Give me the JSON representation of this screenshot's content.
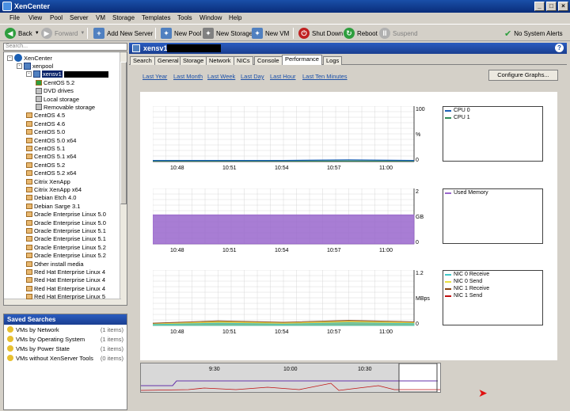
{
  "app": {
    "title": "XenCenter"
  },
  "menu": [
    "File",
    "View",
    "Pool",
    "Server",
    "VM",
    "Storage",
    "Templates",
    "Tools",
    "Window",
    "Help"
  ],
  "toolbar": {
    "back": "Back",
    "forward": "Forward",
    "add_server": "Add New Server",
    "new_pool": "New Pool",
    "new_storage": "New Storage",
    "new_vm": "New VM",
    "shutdown": "Shut Down",
    "reboot": "Reboot",
    "suspend": "Suspend",
    "alerts": "No System Alerts"
  },
  "search": {
    "placeholder": "Search..."
  },
  "tree": [
    {
      "label": "XenCenter",
      "type": "xc",
      "indent": 0,
      "exp": "-"
    },
    {
      "label": "xenpool",
      "type": "pool",
      "indent": 1,
      "exp": "-"
    },
    {
      "label": "xensv1",
      "type": "host",
      "indent": 2,
      "exp": "-"
    },
    {
      "label": "CentOS 5.2",
      "type": "vm-running",
      "indent": 3
    },
    {
      "label": "DVD drives",
      "type": "sr",
      "indent": 3
    },
    {
      "label": "Local storage",
      "type": "sr",
      "indent": 3
    },
    {
      "label": "Removable storage",
      "type": "sr",
      "indent": 3
    },
    {
      "label": "CentOS 4.5",
      "type": "vm",
      "indent": 2
    },
    {
      "label": "CentOS 4.6",
      "type": "vm",
      "indent": 2
    },
    {
      "label": "CentOS 5.0",
      "type": "vm",
      "indent": 2
    },
    {
      "label": "CentOS 5.0 x64",
      "type": "vm",
      "indent": 2
    },
    {
      "label": "CentOS 5.1",
      "type": "vm",
      "indent": 2
    },
    {
      "label": "CentOS 5.1 x64",
      "type": "vm",
      "indent": 2
    },
    {
      "label": "CentOS 5.2",
      "type": "vm",
      "indent": 2
    },
    {
      "label": "CentOS 5.2 x64",
      "type": "vm",
      "indent": 2
    },
    {
      "label": "Citrix XenApp",
      "type": "vm",
      "indent": 2
    },
    {
      "label": "Citrix XenApp x64",
      "type": "vm",
      "indent": 2
    },
    {
      "label": "Debian Etch 4.0",
      "type": "vm",
      "indent": 2
    },
    {
      "label": "Debian Sarge 3.1",
      "type": "vm",
      "indent": 2
    },
    {
      "label": "Oracle Enterprise Linux 5.0",
      "type": "vm",
      "indent": 2
    },
    {
      "label": "Oracle Enterprise Linux 5.0",
      "type": "vm",
      "indent": 2
    },
    {
      "label": "Oracle Enterprise Linux 5.1",
      "type": "vm",
      "indent": 2
    },
    {
      "label": "Oracle Enterprise Linux 5.1",
      "type": "vm",
      "indent": 2
    },
    {
      "label": "Oracle Enterprise Linux 5.2",
      "type": "vm",
      "indent": 2
    },
    {
      "label": "Oracle Enterprise Linux 5.2",
      "type": "vm",
      "indent": 2
    },
    {
      "label": "Other install media",
      "type": "vm",
      "indent": 2
    },
    {
      "label": "Red Hat Enterprise Linux 4",
      "type": "vm",
      "indent": 2
    },
    {
      "label": "Red Hat Enterprise Linux 4",
      "type": "vm",
      "indent": 2
    },
    {
      "label": "Red Hat Enterprise Linux 4",
      "type": "vm",
      "indent": 2
    },
    {
      "label": "Red Hat Enterprise Linux 5",
      "type": "vm",
      "indent": 2
    }
  ],
  "saved_searches": {
    "title": "Saved Searches",
    "items": [
      {
        "label": "VMs by Network",
        "count": "(1 items)"
      },
      {
        "label": "VMs by Operating System",
        "count": "(1 items)"
      },
      {
        "label": "VMs by Power State",
        "count": "(1 items)"
      },
      {
        "label": "VMs without XenServer Tools",
        "count": "(0 items)"
      }
    ]
  },
  "host_header": "xensv1",
  "tabs": [
    "Search",
    "General",
    "Storage",
    "Network",
    "NICs",
    "Console",
    "Performance",
    "Logs"
  ],
  "active_tab": "Performance",
  "time_links": [
    "Last Year",
    "Last Month",
    "Last Week",
    "Last Day",
    "Last Hour",
    "Last Ten Minutes"
  ],
  "configure_button": "Configure Graphs...",
  "x_ticks": [
    "10:48",
    "10:51",
    "10:54",
    "10:57",
    "11:00"
  ],
  "overview_ticks": [
    "9:30",
    "10:00",
    "10:30"
  ],
  "colors": {
    "accent": "#1a4fa8",
    "memory_fill": "#9966cc"
  },
  "chart_data": [
    {
      "type": "line",
      "x": [
        "10:48",
        "10:51",
        "10:54",
        "10:57",
        "11:00"
      ],
      "ylim": [
        0,
        100
      ],
      "y_ticks": [
        "100",
        "%",
        "0"
      ],
      "series": [
        {
          "name": "CPU 0",
          "color": "#1a5fb4",
          "values": [
            2,
            2,
            2,
            3,
            2
          ]
        },
        {
          "name": "CPU 1",
          "color": "#2e8b57",
          "values": [
            1,
            1,
            1,
            1,
            1
          ]
        }
      ]
    },
    {
      "type": "area",
      "x": [
        "10:48",
        "10:51",
        "10:54",
        "10:57",
        "11:00"
      ],
      "ylim": [
        0,
        2
      ],
      "y_ticks": [
        "2",
        "GB",
        "0"
      ],
      "series": [
        {
          "name": "Used Memory",
          "color": "#9966cc",
          "values": [
            1.05,
            1.05,
            1.05,
            1.05,
            1.05
          ]
        }
      ]
    },
    {
      "type": "area",
      "x": [
        "10:48",
        "10:51",
        "10:54",
        "10:57",
        "11:00"
      ],
      "ylim": [
        0,
        1.2
      ],
      "y_ticks": [
        "1.2",
        "MBps",
        "0"
      ],
      "series": [
        {
          "name": "NIC 0 Receive",
          "color": "#40c8c8",
          "values": [
            0.02,
            0.05,
            0.03,
            0.06,
            0.04
          ]
        },
        {
          "name": "NIC 0 Send",
          "color": "#e8e040",
          "values": [
            0.03,
            0.08,
            0.05,
            0.09,
            0.06
          ]
        },
        {
          "name": "NIC 1 Receive",
          "color": "#8b4513",
          "values": [
            0.05,
            0.1,
            0.07,
            0.11,
            0.08
          ]
        },
        {
          "name": "NIC 1 Send",
          "color": "#c01010",
          "values": [
            0.01,
            0.02,
            0.01,
            0.02,
            0.01
          ]
        }
      ]
    }
  ]
}
